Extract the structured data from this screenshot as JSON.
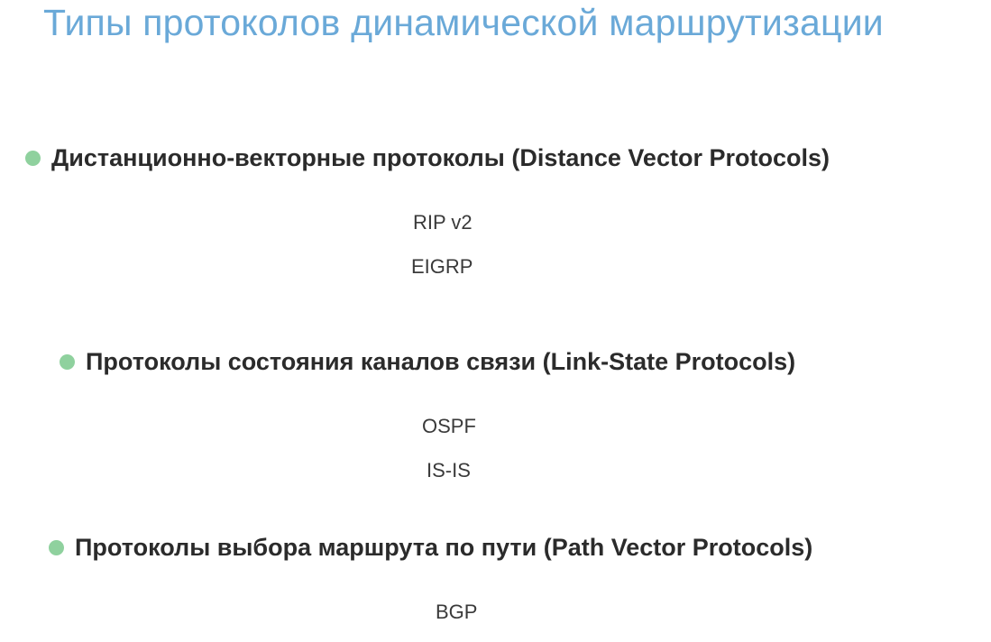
{
  "slide": {
    "title": "Типы протоколов динамической маршрутизации",
    "sections": [
      {
        "heading": "Дистанционно-векторные протоколы (Distance Vector Protocols)",
        "items": [
          "RIP v2",
          "EIGRP"
        ]
      },
      {
        "heading": "Протоколы состояния каналов связи (Link-State Protocols)",
        "items": [
          "OSPF",
          "IS-IS"
        ]
      },
      {
        "heading": "Протоколы выбора маршрута по пути (Path Vector Protocols)",
        "items": [
          "BGP"
        ]
      }
    ]
  },
  "colors": {
    "title": "#6aa9d8",
    "bullet": "#8fd19e",
    "text": "#2b2b2b"
  }
}
